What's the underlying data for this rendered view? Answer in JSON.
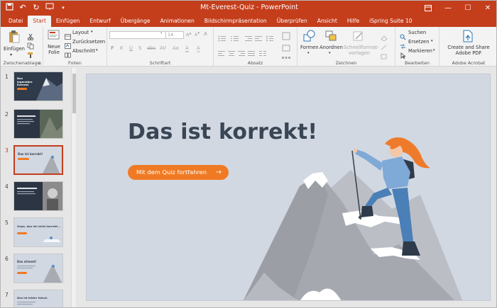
{
  "window": {
    "title": "Mt-Everest-Quiz  -  PowerPoint"
  },
  "tabs": [
    "Datei",
    "Start",
    "Einfügen",
    "Entwurf",
    "Übergänge",
    "Animationen",
    "Bildschirmpräsentation",
    "Überprüfen",
    "Ansicht",
    "Hilfe",
    "iSpring Suite 10"
  ],
  "active_tab": "Start",
  "ribbon": {
    "clipboard": {
      "paste": "Einfügen",
      "label": "Zwischenablage"
    },
    "slides": {
      "new_slide": "Neue Folie",
      "layout": "Layout",
      "reset": "Zurücksetzen",
      "section": "Abschnitt",
      "label": "Folien"
    },
    "font": {
      "size": "14",
      "bold": "F",
      "italic": "K",
      "underline": "U",
      "strike": "S",
      "label": "Schriftart"
    },
    "paragraph": {
      "label": "Absatz"
    },
    "drawing": {
      "shapes": "Formen",
      "arrange": "Anordnen",
      "quick_styles": "Schnellformat-vorlagen",
      "label": "Zeichnen"
    },
    "editing": {
      "find": "Suchen",
      "replace": "Ersetzen",
      "select": "Markieren",
      "label": "Bearbeiten"
    },
    "acrobat": {
      "create_share": "Create and Share Adobe PDF",
      "label": "Adobe Acrobat"
    }
  },
  "thumbnails": [
    {
      "number": "1",
      "text": "Das legendäre Everest",
      "theme": "dark"
    },
    {
      "number": "2",
      "text": "",
      "theme": "dark"
    },
    {
      "number": "3",
      "text": "Das ist korrekt!",
      "theme": "light",
      "selected": true
    },
    {
      "number": "4",
      "text": "",
      "theme": "dark"
    },
    {
      "number": "5",
      "text": "Oops, das ist nicht korrekt...",
      "theme": "light"
    },
    {
      "number": "6",
      "text": "Das stimmt!",
      "theme": "light"
    },
    {
      "number": "7",
      "text": "Das ist leider falsch.",
      "theme": "light"
    }
  ],
  "slide": {
    "headline": "Das ist korrekt!",
    "button_label": "Mit dem Quiz fortfahren",
    "button_arrow": "→"
  },
  "colors": {
    "accent": "#c43e1c",
    "cta": "#f07a23",
    "slide_bg": "#d1d8e2",
    "headline": "#3a4555"
  }
}
